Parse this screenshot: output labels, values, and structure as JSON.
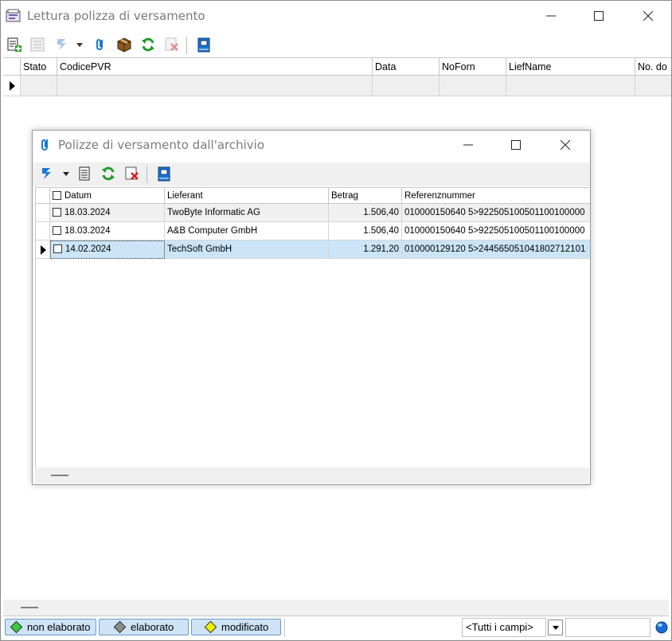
{
  "main_window": {
    "title": "Lettura polizza di versamento",
    "columns": [
      "Stato",
      "CodicePVR",
      "Data",
      "NoForn",
      "LiefName",
      "No. do"
    ],
    "legend": [
      {
        "label": "non elaborato",
        "color": "#3cc83c"
      },
      {
        "label": "elaborato",
        "color": "#8c8c8c"
      },
      {
        "label": "modificato",
        "color": "#f0f000"
      }
    ],
    "filter_value": "<Tutti i campi>"
  },
  "dialog": {
    "title": "Polizze di versamento dall'archivio",
    "columns": [
      "Datum",
      "Lieferant",
      "Betrag",
      "Referenznummer"
    ],
    "rows": [
      {
        "datum": "18.03.2024",
        "lieferant": "TwoByte Informatic AG",
        "betrag": "1.506,40",
        "ref": "010000150640 5>922505100501100100000"
      },
      {
        "datum": "18.03.2024",
        "lieferant": "A&B Computer GmbH",
        "betrag": "1.506,40",
        "ref": "010000150640 5>922505100501100100000"
      },
      {
        "datum": "14.02.2024",
        "lieferant": "TechSoft GmbH",
        "betrag": "1.291,20",
        "ref": "010000129120 5>244565051041802712101"
      }
    ]
  },
  "colors": {
    "selection": "#cce4f7",
    "legend_bg": "#cfe3f7",
    "refresh_green": "#1e9a2a",
    "delete_red": "#d42020"
  }
}
